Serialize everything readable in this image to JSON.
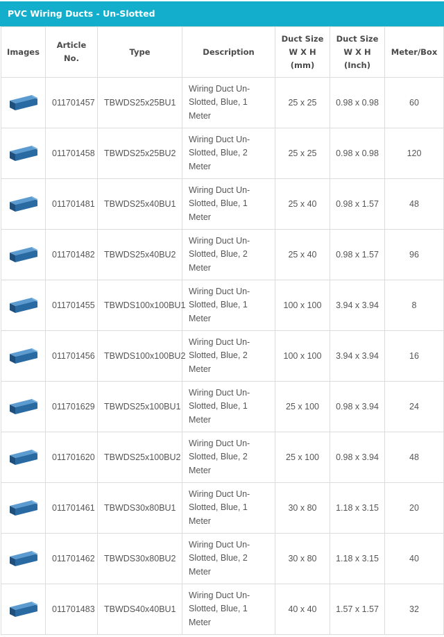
{
  "title": "PVC Wiring Ducts - Un-Slotted",
  "headers": {
    "images": "Images",
    "article_l1": "Article",
    "article_l2": "No.",
    "type": "Type",
    "description": "Description",
    "duct_mm_l1": "Duct Size",
    "duct_mm_l2": "W X H",
    "duct_mm_l3": "(mm)",
    "duct_in_l1": "Duct Size",
    "duct_in_l2": "W X H",
    "duct_in_l3": "(Inch)",
    "meter_box": "Meter/Box"
  },
  "colors": {
    "title_bg": "#12aecb",
    "icon_top": "#5b9bd0",
    "icon_side": "#1f4f7a",
    "icon_front": "#2a6aa3"
  },
  "rows": [
    {
      "icon": "blue-duct-icon",
      "article": "011701457",
      "type": "TBWDS25x25BU1",
      "desc": [
        "Wiring Duct Un-",
        "Slotted, Blue, 1",
        "Meter"
      ],
      "mm": "25 x 25",
      "inch": "0.98 x 0.98",
      "meter": "60"
    },
    {
      "icon": "blue-duct-icon",
      "article": "011701458",
      "type": "TBWDS25x25BU2",
      "desc": [
        "Wiring Duct Un-",
        "Slotted, Blue, 2",
        "Meter"
      ],
      "mm": "25 x 25",
      "inch": "0.98 x 0.98",
      "meter": "120"
    },
    {
      "icon": "blue-duct-icon",
      "article": "011701481",
      "type": "TBWDS25x40BU1",
      "desc": [
        "Wiring Duct Un-",
        "Slotted, Blue, 1",
        "Meter"
      ],
      "mm": "25 x 40",
      "inch": "0.98 x 1.57",
      "meter": "48"
    },
    {
      "icon": "blue-duct-icon",
      "article": "011701482",
      "type": "TBWDS25x40BU2",
      "desc": [
        "Wiring Duct Un-",
        "Slotted, Blue, 2",
        "Meter"
      ],
      "mm": "25 x 40",
      "inch": "0.98 x 1.57",
      "meter": "96"
    },
    {
      "icon": "blue-duct-icon",
      "article": "011701455",
      "type": "TBWDS100x100BU1",
      "desc": [
        "Wiring Duct Un-",
        "Slotted, Blue, 1",
        "Meter"
      ],
      "mm": "100 x 100",
      "inch": "3.94 x 3.94",
      "meter": "8"
    },
    {
      "icon": "blue-duct-icon",
      "article": "011701456",
      "type": "TBWDS100x100BU2",
      "desc": [
        "Wiring Duct Un-",
        "Slotted, Blue, 2",
        "Meter"
      ],
      "mm": "100 x 100",
      "inch": "3.94 x 3.94",
      "meter": "16"
    },
    {
      "icon": "blue-duct-icon",
      "article": "011701629",
      "type": "TBWDS25x100BU1",
      "desc": [
        "Wiring Duct Un-",
        "Slotted, Blue, 1",
        "Meter"
      ],
      "mm": "25 x 100",
      "inch": "0.98 x 3.94",
      "meter": "24"
    },
    {
      "icon": "blue-duct-icon",
      "article": "011701620",
      "type": "TBWDS25x100BU2",
      "desc": [
        "Wiring Duct Un-",
        "Slotted, Blue, 2",
        "Meter"
      ],
      "mm": "25 x 100",
      "inch": "0.98 x 3.94",
      "meter": "48"
    },
    {
      "icon": "blue-duct-icon",
      "article": "011701461",
      "type": "TBWDS30x80BU1",
      "desc": [
        "Wiring Duct Un-",
        "Slotted, Blue, 1",
        "Meter"
      ],
      "mm": "30 x 80",
      "inch": "1.18 x 3.15",
      "meter": "20"
    },
    {
      "icon": "blue-duct-icon",
      "article": "011701462",
      "type": "TBWDS30x80BU2",
      "desc": [
        "Wiring Duct Un-",
        "Slotted, Blue, 2",
        "Meter"
      ],
      "mm": "30 x 80",
      "inch": "1.18 x 3.15",
      "meter": "40"
    },
    {
      "icon": "blue-duct-icon",
      "article": "011701483",
      "type": "TBWDS40x40BU1",
      "desc": [
        "Wiring Duct Un-",
        "Slotted, Blue, 1",
        "Meter"
      ],
      "mm": "40 x 40",
      "inch": "1.57 x 1.57",
      "meter": "32"
    }
  ]
}
